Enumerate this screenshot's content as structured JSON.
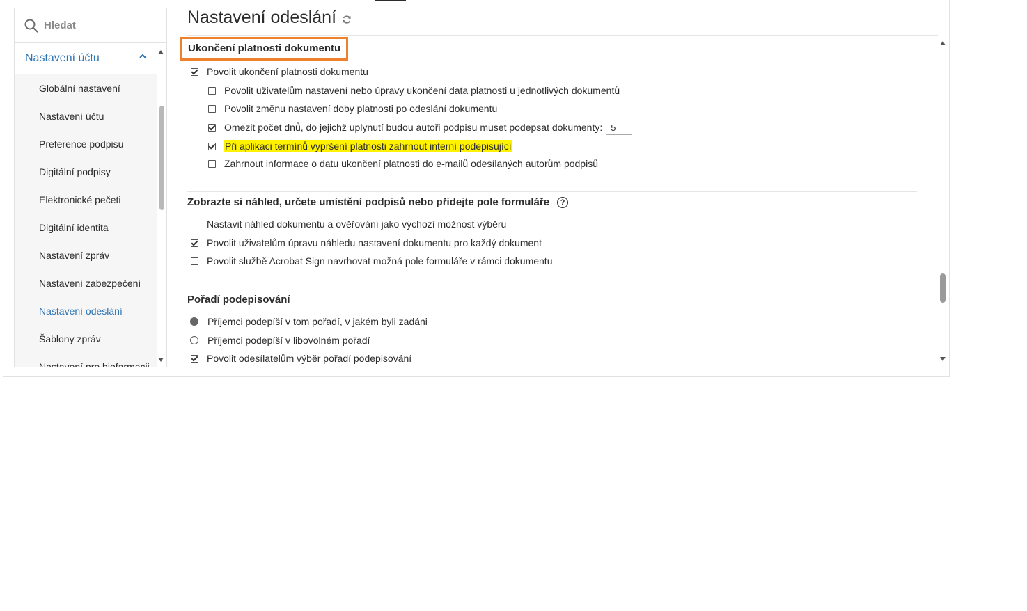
{
  "sidebar": {
    "search_placeholder": "Hledat",
    "section_label": "Nastavení účtu",
    "items": [
      {
        "label": "Globální nastavení"
      },
      {
        "label": "Nastavení účtu"
      },
      {
        "label": "Preference podpisu"
      },
      {
        "label": "Digitální podpisy"
      },
      {
        "label": "Elektronické pečeti"
      },
      {
        "label": "Digitální identita"
      },
      {
        "label": "Nastavení zpráv"
      },
      {
        "label": "Nastavení zabezpečení"
      },
      {
        "label": "Nastavení odeslání",
        "active": true
      },
      {
        "label": "Šablony zpráv"
      },
      {
        "label": "Nastavení pro biofarmacii"
      }
    ]
  },
  "main": {
    "title": "Nastavení odeslání",
    "expiration": {
      "title": "Ukončení platnosti dokumentu",
      "enable": {
        "label": "Povolit ukončení platnosti dokumentu",
        "checked": true
      },
      "options": [
        {
          "label": "Povolit uživatelům nastavení nebo úpravy ukončení data platnosti u jednotlivých dokumentů",
          "checked": false
        },
        {
          "label": "Povolit změnu nastavení doby platnosti po odeslání dokumentu",
          "checked": false
        },
        {
          "label": "Omezit počet dnů, do jejichž uplynutí budou autoři podpisu muset podepsat dokumenty:",
          "checked": true,
          "value": "5"
        },
        {
          "label": "Při aplikaci termínů vypršení platnosti zahrnout interní podepisující",
          "checked": true
        },
        {
          "label": "Zahrnout informace o datu ukončení platnosti do e-mailů odesílaných autorům podpisů",
          "checked": false
        }
      ]
    },
    "preview": {
      "title": "Zobrazte si náhled, určete umístění podpisů nebo přidejte pole formuláře",
      "help": "?",
      "options": [
        {
          "label": "Nastavit náhled dokumentu a ověřování jako výchozí možnost výběru",
          "checked": false
        },
        {
          "label": "Povolit uživatelům úpravu náhledu nastavení dokumentu pro každý dokument",
          "checked": true
        },
        {
          "label": "Povolit službě Acrobat Sign navrhovat možná pole formuláře v rámci dokumentu",
          "checked": false
        }
      ]
    },
    "order": {
      "title": "Pořadí podepisování",
      "options": [
        {
          "label": "Příjemci podepíší v tom pořadí, v jakém byli zadáni",
          "selected": true
        },
        {
          "label": "Příjemci podepíší v libovolném pořadí",
          "selected": false
        }
      ],
      "allow": {
        "label": "Povolit odesílatelům výběr pořadí podepisování",
        "checked": true
      }
    }
  },
  "colors": {
    "accent": "#2d74b5",
    "highlight_border": "#f0812c",
    "highlight_text": "#fff200"
  }
}
